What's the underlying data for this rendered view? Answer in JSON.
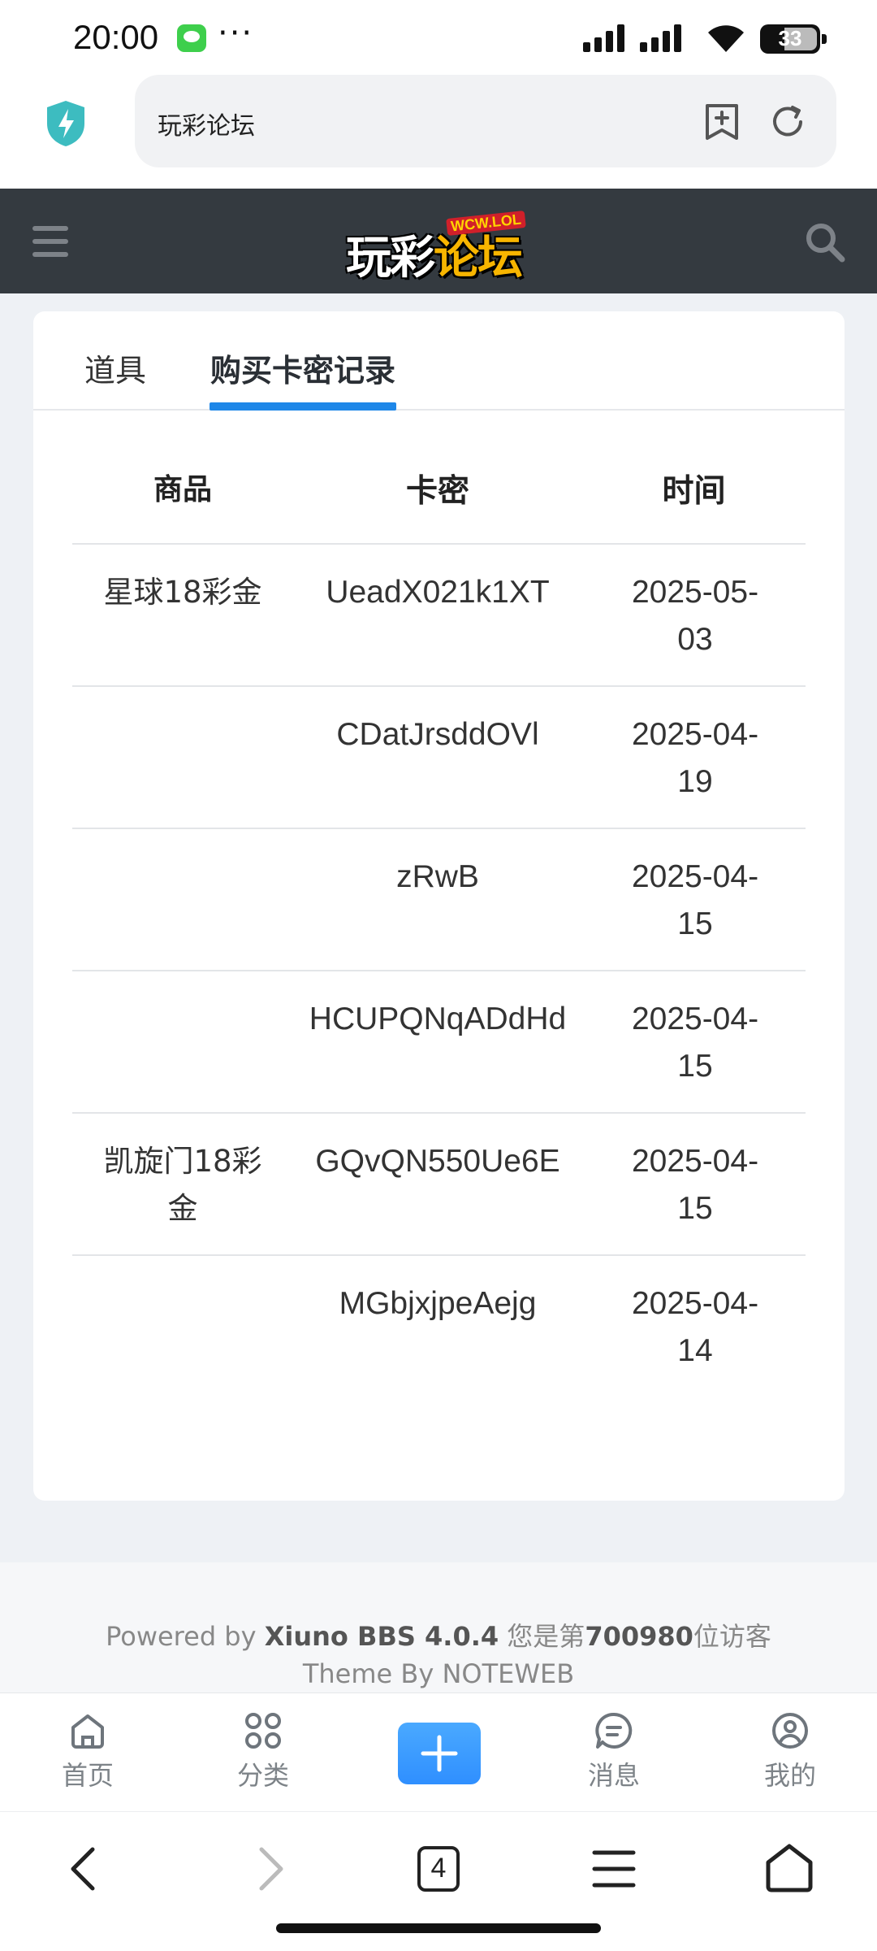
{
  "status_bar": {
    "time": "20:00",
    "dots": "···",
    "battery": "33"
  },
  "browser": {
    "url_text": "玩彩论坛"
  },
  "forum": {
    "logo_main_1": "玩彩",
    "logo_main_2": "论坛",
    "logo_sub": "WCW.LOL"
  },
  "tabs": [
    {
      "label": "道具",
      "active": false
    },
    {
      "label": "购买卡密记录",
      "active": true
    }
  ],
  "table": {
    "headers": [
      "商品",
      "卡密",
      "时间"
    ],
    "rows": [
      {
        "product": "星球18彩金",
        "code": "UeadX021k1XT",
        "time": "2025-05-03"
      },
      {
        "product": "",
        "code": "CDatJrsddOVl",
        "time": "2025-04-19"
      },
      {
        "product": "",
        "code": "zRwB",
        "time": "2025-04-15"
      },
      {
        "product": "",
        "code": "HCUPQNqADdHd",
        "time": "2025-04-15"
      },
      {
        "product": "凯旋门18彩金",
        "code": "GQvQN550Ue6E",
        "time": "2025-04-15"
      },
      {
        "product": "",
        "code": "MGbjxjpeAejg",
        "time": "2025-04-14"
      }
    ]
  },
  "footer": {
    "powered_prefix": "Powered by ",
    "powered_name": "Xiuno BBS 4.0.4",
    "visitor_prefix": " 您是第",
    "visitor_count": "700980",
    "visitor_suffix": "位访客",
    "theme": "Theme By NOTEWEB"
  },
  "bottom_nav": {
    "home": "首页",
    "category": "分类",
    "messages": "消息",
    "mine": "我的"
  },
  "sys_toolbar": {
    "tab_count": "4"
  },
  "colors": {
    "header_bg": "#343a40",
    "accent": "#1e87e8",
    "add_button": "#3a9bff"
  }
}
